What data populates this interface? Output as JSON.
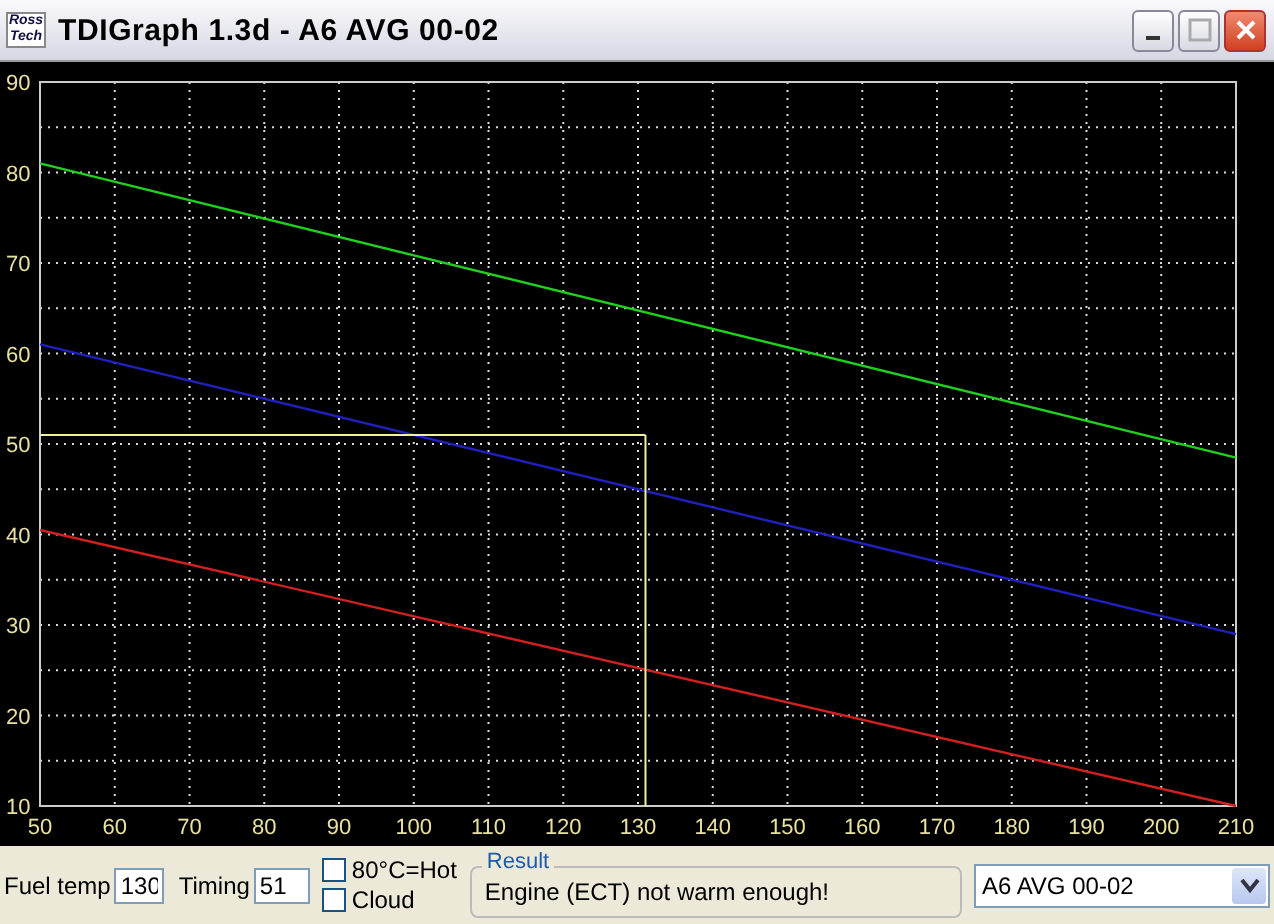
{
  "window": {
    "title": "TDIGraph 1.3d - A6 AVG 00-02",
    "logo": "Ross Tech"
  },
  "chart": {
    "chart_data": {
      "type": "line",
      "x": [
        50,
        210
      ],
      "xlim": [
        50,
        210
      ],
      "ylim": [
        10,
        90
      ],
      "xticks": [
        50,
        60,
        70,
        80,
        90,
        100,
        110,
        120,
        130,
        140,
        150,
        160,
        170,
        180,
        190,
        200,
        210
      ],
      "yticks": [
        10,
        20,
        30,
        40,
        50,
        60,
        70,
        80,
        90
      ],
      "series": [
        {
          "color": "#20d020",
          "values": [
            81,
            48.5
          ]
        },
        {
          "color": "#2020c0",
          "values": [
            61,
            29
          ]
        },
        {
          "color": "#d02020",
          "values": [
            40.5,
            10
          ]
        }
      ],
      "grid": true,
      "ref_lines": [
        {
          "axis": "y",
          "value": 51,
          "color": "#f0f0a0"
        },
        {
          "axis": "x",
          "value": 131,
          "color": "#f0f0a0"
        }
      ]
    }
  },
  "controls": {
    "fuel_temp": {
      "label": "Fuel temp",
      "value": "130"
    },
    "timing": {
      "label": "Timing",
      "value": "51"
    },
    "checkboxes": [
      {
        "label": "80°C=Hot",
        "checked": false
      },
      {
        "label": "Cloud",
        "checked": false
      }
    ],
    "result": {
      "title": "Result",
      "text": "Engine (ECT) not warm enough!"
    },
    "profile": {
      "value": "A6 AVG 00-02"
    }
  }
}
